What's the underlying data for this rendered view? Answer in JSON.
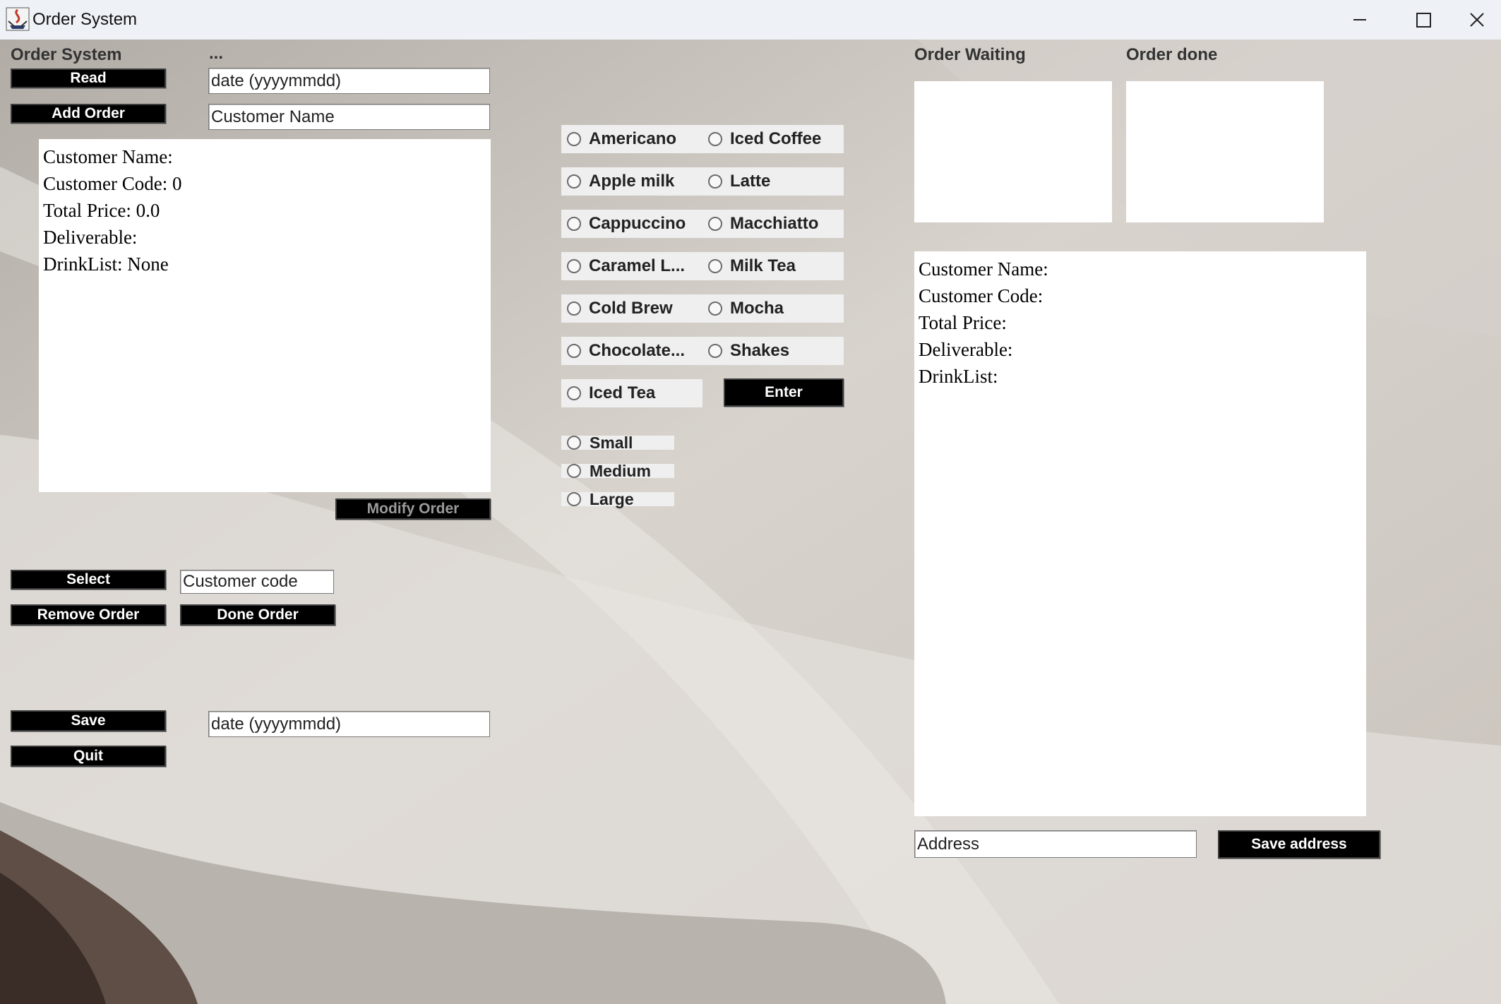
{
  "window": {
    "title": "Order System",
    "controls": {
      "minimize": "─",
      "maximize": "☐",
      "close": "✕"
    }
  },
  "left": {
    "heading": "Order System",
    "ellipsis": "...",
    "read_button": "Read",
    "date_field": {
      "value": "",
      "placeholder": "date (yyyymmdd)"
    },
    "add_order_button": "Add Order",
    "customer_name_field": {
      "value": "",
      "placeholder": "Customer Name"
    },
    "order_info": [
      "Customer Name:",
      "Customer Code: 0",
      "Total Price: 0.0",
      "Deliverable:",
      "DrinkList: None"
    ],
    "modify_order_button": "Modify Order",
    "select_button": "Select",
    "customer_code_field": {
      "value": "",
      "placeholder": "Customer code"
    },
    "remove_order_button": "Remove Order",
    "done_order_button": "Done Order",
    "save_button": "Save",
    "save_date_field": {
      "value": "",
      "placeholder": "date (yyyymmdd)"
    },
    "quit_button": "Quit"
  },
  "drinks": {
    "options": [
      "Americano",
      "Iced Coffee",
      "Apple milk",
      "Latte",
      "Cappuccino",
      "Macchiatto",
      "Caramel L...",
      "Milk Tea",
      "Cold Brew",
      "Mocha",
      "Chocolate...",
      "Shakes",
      "Iced Tea"
    ],
    "enter_button": "Enter",
    "sizes": [
      "Small",
      "Medium",
      "Large"
    ]
  },
  "right": {
    "order_waiting_label": "Order Waiting",
    "order_done_label": "Order done",
    "details": [
      "Customer Name:",
      "Customer Code:",
      "Total Price:",
      "Deliverable:",
      "DrinkList:"
    ],
    "address_field": {
      "value": "",
      "placeholder": "Address"
    },
    "save_address_button": "Save address"
  },
  "colors": {
    "background": "#cfc9c2",
    "button": "#000000",
    "button_text": "#ffffff",
    "option_bg": "#efefef",
    "titlebar": "#eef2f7"
  }
}
